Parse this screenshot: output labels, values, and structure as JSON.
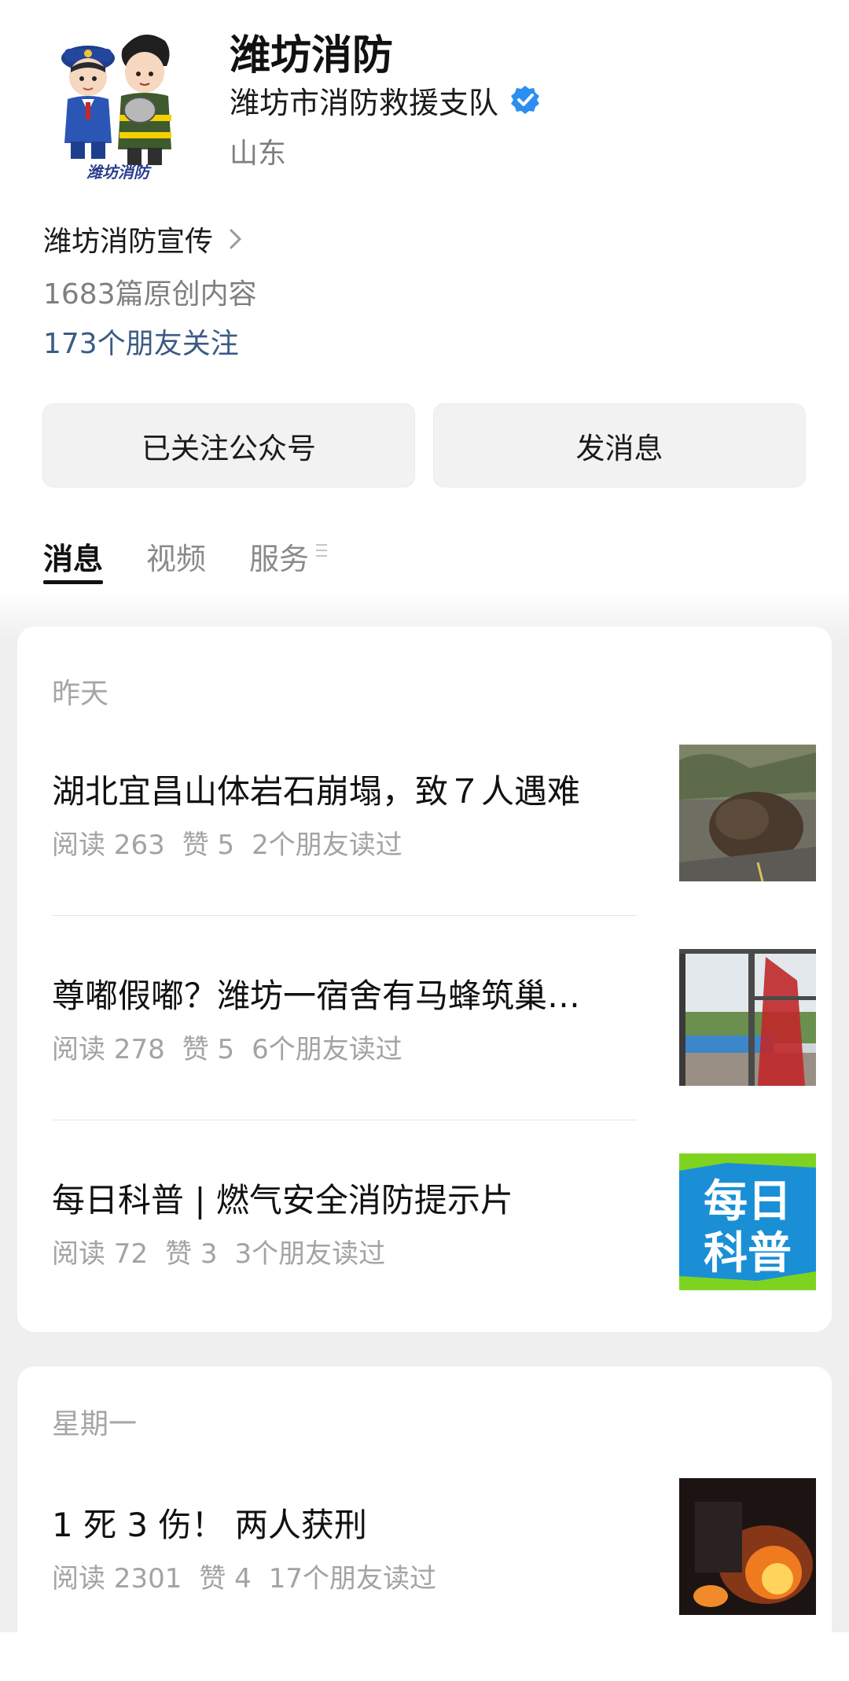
{
  "account": {
    "name": "潍坊消防",
    "org": "潍坊市消防救援支队",
    "region": "山东",
    "avatar_text": "潍坊消防"
  },
  "info": {
    "promo": "潍坊消防宣传",
    "original": "1683篇原创内容",
    "friends": "173个朋友关注"
  },
  "buttons": {
    "follow": "已关注公众号",
    "message": "发消息"
  },
  "tabs": [
    "消息",
    "视频",
    "服务"
  ],
  "groups": [
    {
      "day": "昨天",
      "articles": [
        {
          "title": "湖北宜昌山体岩石崩塌，致７人遇难",
          "reads": "阅读 263",
          "likes": "赞 5",
          "friends": "2个朋友读过"
        },
        {
          "title": "尊嘟假嘟？潍坊一宿舍有马蜂筑巢…",
          "reads": "阅读 278",
          "likes": "赞 5",
          "friends": "6个朋友读过"
        },
        {
          "title": "每日科普 | 燃气安全消防提示片",
          "reads": "阅读 72",
          "likes": "赞 3",
          "friends": "3个朋友读过",
          "thumb_text": [
            "每日",
            "科普"
          ]
        }
      ]
    },
    {
      "day": "星期一",
      "articles": [
        {
          "title": "1 死 3 伤！ 两人获刑",
          "reads": "阅读 2301",
          "likes": "赞 4",
          "friends": "17个朋友读过"
        }
      ]
    }
  ],
  "colors": {
    "link": "#3b5b85",
    "verified": "#2b8ef0",
    "thumb_blue": "#1a8fd6",
    "thumb_green": "#7ed321"
  }
}
